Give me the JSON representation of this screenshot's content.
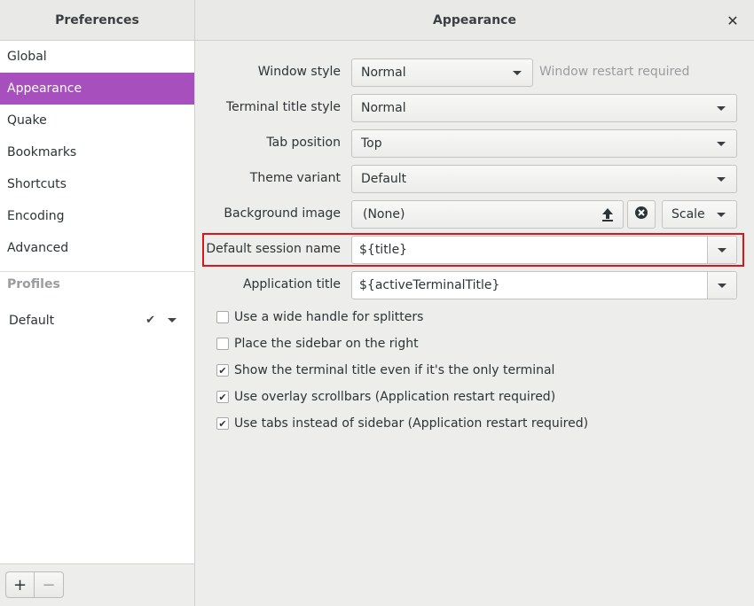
{
  "header": {
    "left_title": "Preferences",
    "right_title": "Appearance",
    "close_glyph": "✕"
  },
  "sidebar": {
    "items": [
      {
        "label": "Global"
      },
      {
        "label": "Appearance"
      },
      {
        "label": "Quake"
      },
      {
        "label": "Bookmarks"
      },
      {
        "label": "Shortcuts"
      },
      {
        "label": "Encoding"
      },
      {
        "label": "Advanced"
      }
    ],
    "active_index": 1,
    "profiles_header": "Profiles",
    "profiles": [
      {
        "label": "Default",
        "checked": true
      }
    ],
    "add_label": "+",
    "remove_label": "−"
  },
  "form": {
    "window_style": {
      "label": "Window style",
      "value": "Normal",
      "note": "Window restart required"
    },
    "terminal_title_style": {
      "label": "Terminal title style",
      "value": "Normal"
    },
    "tab_position": {
      "label": "Tab position",
      "value": "Top"
    },
    "theme_variant": {
      "label": "Theme variant",
      "value": "Default"
    },
    "background_image": {
      "label": "Background image",
      "value": "(None)",
      "mode": "Scale"
    },
    "default_session_name": {
      "label": "Default session name",
      "value": "${title}"
    },
    "application_title": {
      "label": "Application title",
      "value": "${activeTerminalTitle}"
    }
  },
  "checkboxes": [
    {
      "label": "Use a wide handle for splitters",
      "checked": false
    },
    {
      "label": "Place the sidebar on the right",
      "checked": false
    },
    {
      "label": "Show the terminal title even if it's the only terminal",
      "checked": true
    },
    {
      "label": "Use overlay scrollbars (Application restart required)",
      "checked": true
    },
    {
      "label": "Use tabs instead of sidebar (Application restart required)",
      "checked": true
    }
  ],
  "colors": {
    "accent": "#a64fbd",
    "highlight_border": "#d9161a"
  },
  "icons": {
    "upload": "upload-icon",
    "clear": "clear-icon",
    "check": "check-icon"
  }
}
